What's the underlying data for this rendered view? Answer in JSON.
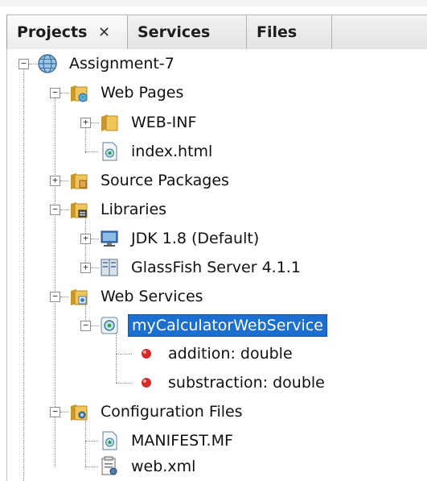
{
  "tabs": [
    {
      "label": "Projects",
      "close": "✕"
    },
    {
      "label": "Services"
    },
    {
      "label": "Files"
    }
  ],
  "tree": {
    "project": "Assignment-7",
    "web_pages": "Web Pages",
    "web_inf": "WEB-INF",
    "index_html": "index.html",
    "source_packages": "Source Packages",
    "libraries": "Libraries",
    "jdk": "JDK 1.8 (Default)",
    "glassfish": "GlassFish Server 4.1.1",
    "web_services": "Web Services",
    "my_calc": "myCalculatorWebService",
    "addition": "addition: double",
    "substraction": "substraction: double",
    "config_files": "Configuration Files",
    "manifest": "MANIFEST.MF",
    "web_xml": "web.xml"
  },
  "selected_item": "myCalculatorWebService",
  "colors": {
    "selection": "#1a6fd0",
    "folder": "#e6b84a",
    "operation": "#d42a2a"
  }
}
